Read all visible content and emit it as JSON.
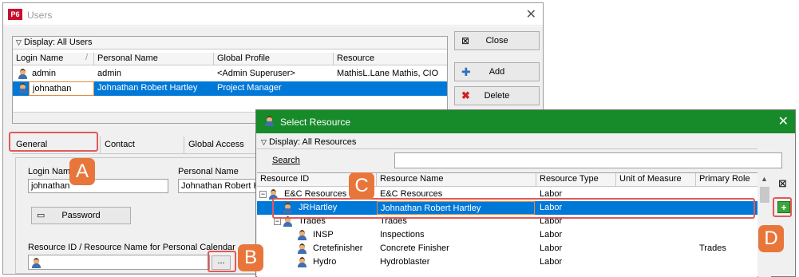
{
  "users_window": {
    "logo": "P6",
    "title": "Users",
    "close_glyph": "✕",
    "display_label": "Display: All Users",
    "columns": [
      "Login Name",
      "Personal Name",
      "Global Profile",
      "Resource"
    ],
    "rows": [
      {
        "login": "admin",
        "personal": "admin",
        "profile": "<Admin Superuser>",
        "resource": "MathisL.Lane Mathis, CIO"
      },
      {
        "login": "johnathan",
        "personal": "Johnathan Robert Hartley",
        "profile": "Project Manager",
        "resource": ""
      }
    ],
    "buttons": {
      "close": "Close",
      "add": "Add",
      "delete": "Delete"
    },
    "tabs": [
      "General",
      "Contact",
      "Global Access"
    ],
    "general": {
      "login_label": "Login Name",
      "login_value": "johnathan",
      "personal_label": "Personal Name",
      "personal_value": "Johnathan Robert Hartley",
      "password_button": "Password",
      "resource_label": "Resource ID / Resource Name for Personal Calendar",
      "browse_button": "..."
    }
  },
  "select_resource": {
    "title": "Select Resource",
    "display_label": "Display: All Resources",
    "search_label": "Search",
    "search_value": "",
    "columns": [
      "Resource ID",
      "Resource Name",
      "Resource Type",
      "Unit of Measure",
      "Primary Role"
    ],
    "rows": [
      {
        "id": "E&C Resources",
        "name": "E&C Resources",
        "type": "Labor",
        "uom": "",
        "role": "",
        "level": 0,
        "toggle": "−"
      },
      {
        "id": "JRHartley",
        "name": "Johnathan Robert Hartley",
        "type": "Labor",
        "uom": "",
        "role": "",
        "level": 1,
        "toggle": ""
      },
      {
        "id": "Trades",
        "name": "Trades",
        "type": "Labor",
        "uom": "",
        "role": "",
        "level": 1,
        "toggle": "−"
      },
      {
        "id": "INSP",
        "name": "Inspections",
        "type": "Labor",
        "uom": "",
        "role": "",
        "level": 2,
        "toggle": ""
      },
      {
        "id": "Cretefinisher",
        "name": "Concrete Finisher",
        "type": "Labor",
        "uom": "",
        "role": "Trades",
        "level": 2,
        "toggle": ""
      },
      {
        "id": "Hydro",
        "name": "Hydroblaster",
        "type": "Labor",
        "uom": "",
        "role": "",
        "level": 2,
        "toggle": ""
      }
    ],
    "selected_index": 1
  },
  "annotations": {
    "badges": [
      "A",
      "B",
      "C",
      "D"
    ],
    "color": "#e8763b",
    "highlight_color": "#e05a5a"
  },
  "icons": [
    "p6-logo",
    "person-icon",
    "close-window-icon",
    "add-plus-icon",
    "delete-x-icon",
    "password-icon",
    "assign-icon"
  ]
}
